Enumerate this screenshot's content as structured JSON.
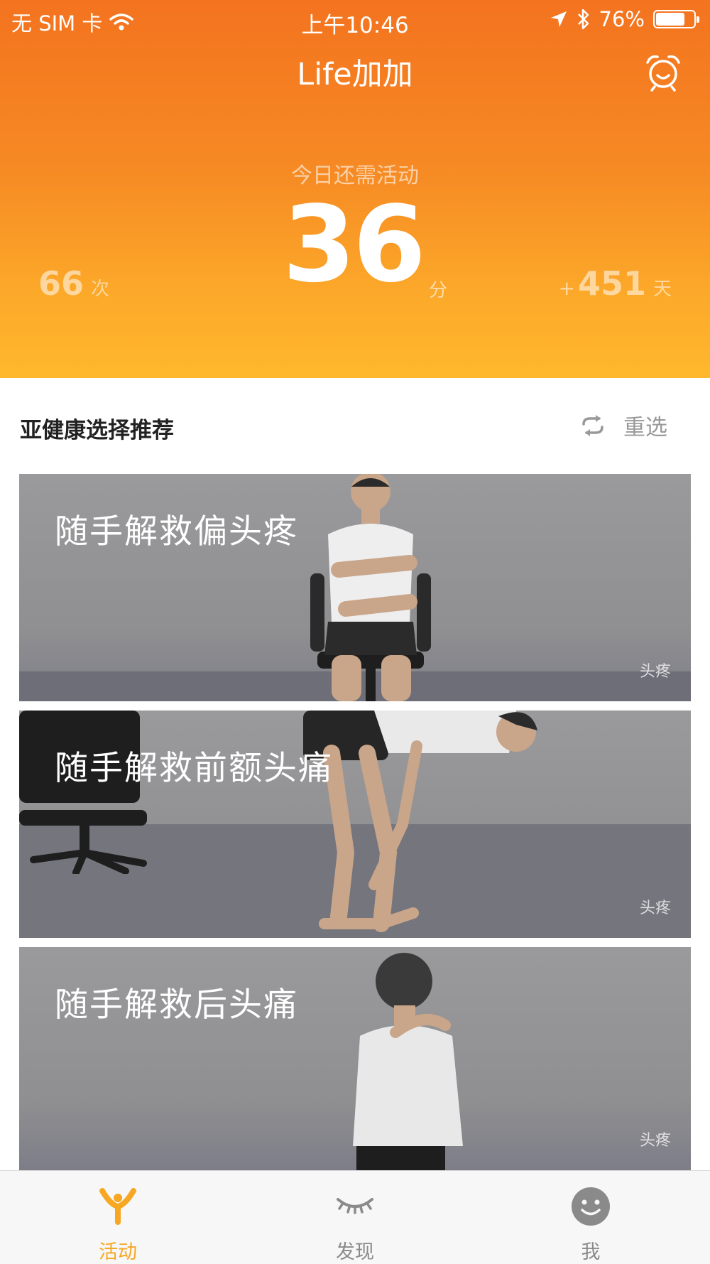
{
  "status_bar": {
    "carrier": "无 SIM 卡",
    "time": "上午10:46",
    "battery_percent": "76%",
    "battery_level": 0.76
  },
  "nav": {
    "title": "Life加加"
  },
  "summary": {
    "label": "今日还需活动",
    "minutes": "36",
    "minutes_unit": "分",
    "count": "66",
    "count_unit": "次",
    "days_prefix": "+",
    "days": "451",
    "days_unit": "天"
  },
  "section": {
    "title": "亚健康选择推荐",
    "refresh_label": "重选"
  },
  "cards": [
    {
      "title": "随手解救偏头疼",
      "tag": "头疼"
    },
    {
      "title": "随手解救前额头痛",
      "tag": "头疼"
    },
    {
      "title": "随手解救后头痛",
      "tag": "头疼"
    }
  ],
  "tabs": [
    {
      "label": "活动",
      "icon": "activity-icon",
      "active": true
    },
    {
      "label": "发现",
      "icon": "closed-eye-icon",
      "active": false
    },
    {
      "label": "我",
      "icon": "smiley-face-icon",
      "active": false
    }
  ],
  "colors": {
    "header_top": "#f4731f",
    "header_bottom": "#ffb82c",
    "tab_active": "#f7a722",
    "tab_inactive": "#8a8a8a"
  }
}
